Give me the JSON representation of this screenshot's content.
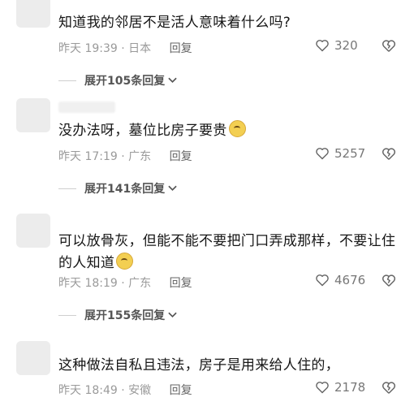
{
  "comments": [
    {
      "text": "知道我的邻居不是活人意味着什么吗?",
      "time": "昨天 19:39 · 日本",
      "reply_label": "回复",
      "likes": "320",
      "expand_label": "展开105条回复"
    },
    {
      "text": "没办法呀，墓位比房子要贵",
      "time": "昨天 17:19 · 广东",
      "reply_label": "回复",
      "likes": "5257",
      "expand_label": "展开141条回复"
    },
    {
      "text": "可以放骨灰，但能不能不要把门口弄成那样，不要让住的人知道",
      "time": "昨天 18:19 · 广东",
      "reply_label": "回复",
      "likes": "4676",
      "expand_label": "展开155条回复"
    },
    {
      "text": "这种做法自私且违法，房子是用来给人住的，",
      "time": "昨天 18:49 · 安徽",
      "reply_label": "回复",
      "likes": "2178"
    }
  ],
  "icons": {
    "like": "heart-outline-icon",
    "dislike": "broken-heart-icon",
    "expand": "chevron-down-icon",
    "emoji": "crying-face-emoji"
  },
  "colors": {
    "meta": "#9a9a9a",
    "text": "#161616",
    "background": "#ffffff"
  }
}
